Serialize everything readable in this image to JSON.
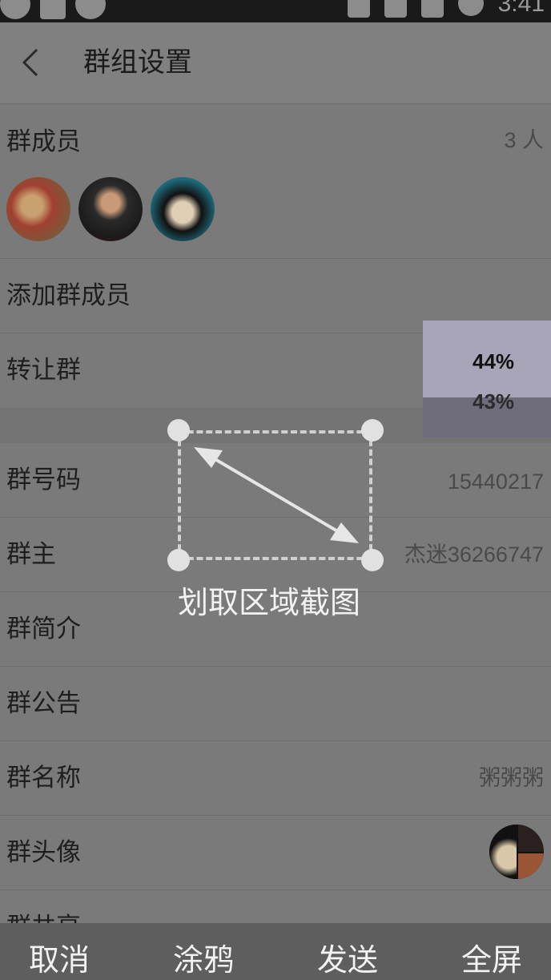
{
  "status_bar": {
    "time": "3:41",
    "icons": [
      "app-icon",
      "notification-icon",
      "link-icon",
      "vibrate-icon",
      "wifi-icon",
      "no-sim-icon",
      "battery-icon"
    ]
  },
  "header": {
    "title": "群组设置",
    "back_icon": "back-arrow-icon"
  },
  "members": {
    "label": "群成员",
    "count": "3 人",
    "avatars": [
      "member-avatar-1",
      "member-avatar-2",
      "member-avatar-3"
    ]
  },
  "add_member": {
    "label": "添加群成员"
  },
  "transfer": {
    "label": "转让群"
  },
  "group_number": {
    "label": "群号码",
    "value": "15440217"
  },
  "owner": {
    "label": "群主",
    "value": "杰迷36266747"
  },
  "intro": {
    "label": "群简介"
  },
  "notice": {
    "label": "群公告"
  },
  "name": {
    "label": "群名称",
    "value": "粥粥粥"
  },
  "group_avatar": {
    "label": "群头像"
  },
  "share": {
    "label": "群共享"
  },
  "overlay": {
    "percent_top": "44%",
    "percent_bottom": "43%",
    "hint": "划取区域截图"
  },
  "bottom_bar": {
    "cancel": "取消",
    "doodle": "涂鸦",
    "send": "发送",
    "fullscreen": "全屏"
  }
}
